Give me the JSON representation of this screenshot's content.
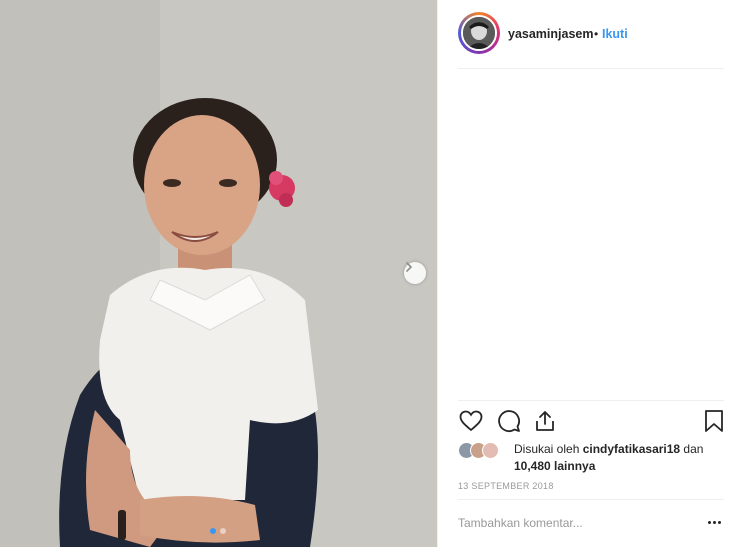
{
  "post": {
    "username": "yasaminjasem",
    "separator": "•",
    "follow_label": "Ikuti",
    "likes_prefix": "Disukai oleh ",
    "liked_by": "cindyfatikasari18",
    "likes_suffix": " dan",
    "likes_others": "10,480 lainnya",
    "date": "13 SEPTEMBER 2018",
    "comment_placeholder": "Tambahkan komentar...",
    "carousel_dots": 2,
    "active_dot": 0
  },
  "icons": {
    "like": "heart-icon",
    "comment": "comment-icon",
    "share": "share-icon",
    "save": "bookmark-icon",
    "next": "chevron-right-icon",
    "more": "more-options-icon"
  },
  "colors": {
    "link": "#3897f0",
    "text": "#262626",
    "muted": "#999999",
    "divider": "#efefef"
  }
}
